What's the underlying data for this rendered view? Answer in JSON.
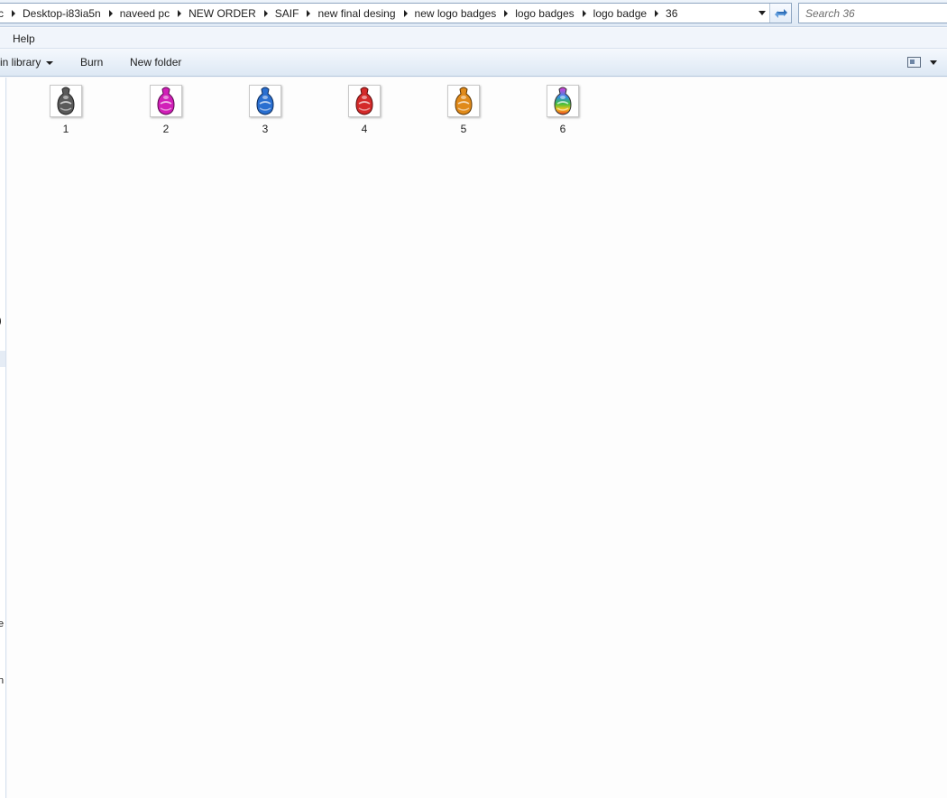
{
  "address_bar": {
    "crumbs": [
      "c",
      "Desktop-i83ia5n",
      "naveed pc",
      "NEW ORDER",
      "SAIF",
      "new final desing",
      "new logo badges",
      "logo badges",
      "logo badge",
      "36"
    ]
  },
  "search": {
    "placeholder": "Search 36"
  },
  "menu": {
    "help": "Help"
  },
  "toolbar": {
    "include_label": "in library",
    "burn_label": "Burn",
    "new_folder_label": "New folder"
  },
  "nav_fragments": {
    "a": ")",
    "b": "e",
    "c": "n"
  },
  "files": [
    {
      "name": "1",
      "color": "#5a5a5a"
    },
    {
      "name": "2",
      "color": "#d11fb8"
    },
    {
      "name": "3",
      "color": "#2a6fd0"
    },
    {
      "name": "4",
      "color": "#d42a2a"
    },
    {
      "name": "5",
      "color": "#e08a1a"
    },
    {
      "name": "6",
      "color": "#3fbf3a"
    }
  ],
  "icons": {
    "refresh": "refresh-icon",
    "view": "view-options-icon",
    "badge": "logo-badge-icon"
  }
}
